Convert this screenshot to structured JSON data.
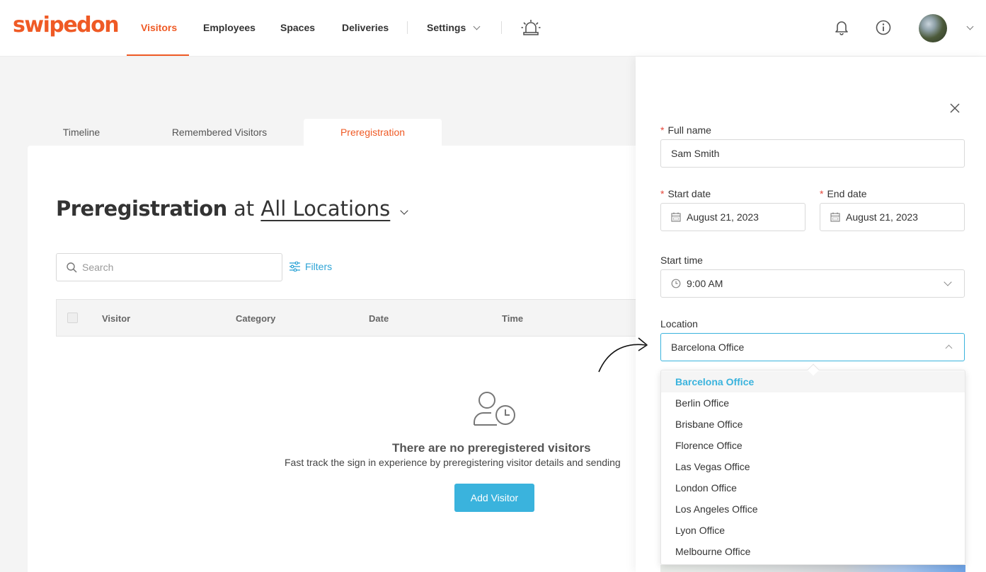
{
  "brand": {
    "logo": "swipedon",
    "accent": "#ef5a25",
    "link": "#3ab3dd"
  },
  "nav": {
    "items": [
      {
        "label": "Visitors",
        "active": true
      },
      {
        "label": "Employees"
      },
      {
        "label": "Spaces"
      },
      {
        "label": "Deliveries"
      },
      {
        "label": "Settings"
      }
    ],
    "icons": [
      "alarm-icon",
      "bell-icon",
      "info-icon",
      "avatar"
    ]
  },
  "tabs": [
    "Timeline",
    "Remembered Visitors",
    "Preregistration"
  ],
  "page": {
    "title": "Preregistration",
    "at": "at",
    "location": "All Locations",
    "search_placeholder": "Search",
    "filters_label": "Filters"
  },
  "table": {
    "columns": [
      "Visitor",
      "Category",
      "Date",
      "Time"
    ]
  },
  "empty": {
    "title": "There are no preregistered visitors",
    "description": "Fast track the sign in experience by preregistering visitor details and sending",
    "button": "Add Visitor"
  },
  "form": {
    "full_name_label": "Full name",
    "full_name_value": "Sam Smith",
    "start_date_label": "Start date",
    "start_date_value": "August 21, 2023",
    "end_date_label": "End date",
    "end_date_value": "August 21, 2023",
    "start_time_label": "Start time",
    "start_time_value": "9:00 AM",
    "location_label": "Location",
    "location_value": "Barcelona Office",
    "location_options": [
      "Barcelona Office",
      "Berlin Office",
      "Brisbane Office",
      "Florence Office",
      "Las Vegas Office",
      "London Office",
      "Los Angeles Office",
      "Lyon Office",
      "Melbourne Office"
    ],
    "selected_option": "Barcelona Office"
  }
}
